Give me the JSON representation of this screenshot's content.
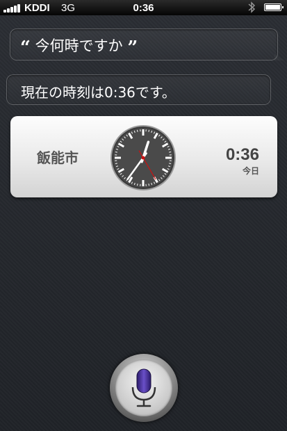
{
  "status_bar": {
    "carrier": "KDDI",
    "network": "3G",
    "time": "0:36"
  },
  "conversation": {
    "user_query": "今何時ですか",
    "open_quote": "“",
    "close_quote": "”",
    "siri_response": "現在の時刻は0:36です。"
  },
  "clock_card": {
    "city": "飯能市",
    "time": "0:36",
    "day": "今日",
    "clock_hands": {
      "hour": 0,
      "minute": 36,
      "second": 25
    }
  },
  "icons": [
    "signal-icon",
    "bluetooth-icon",
    "battery-icon",
    "microphone-icon"
  ],
  "colors": {
    "accent_mic": "#4b2fa0",
    "second_hand": "#cc1111"
  }
}
